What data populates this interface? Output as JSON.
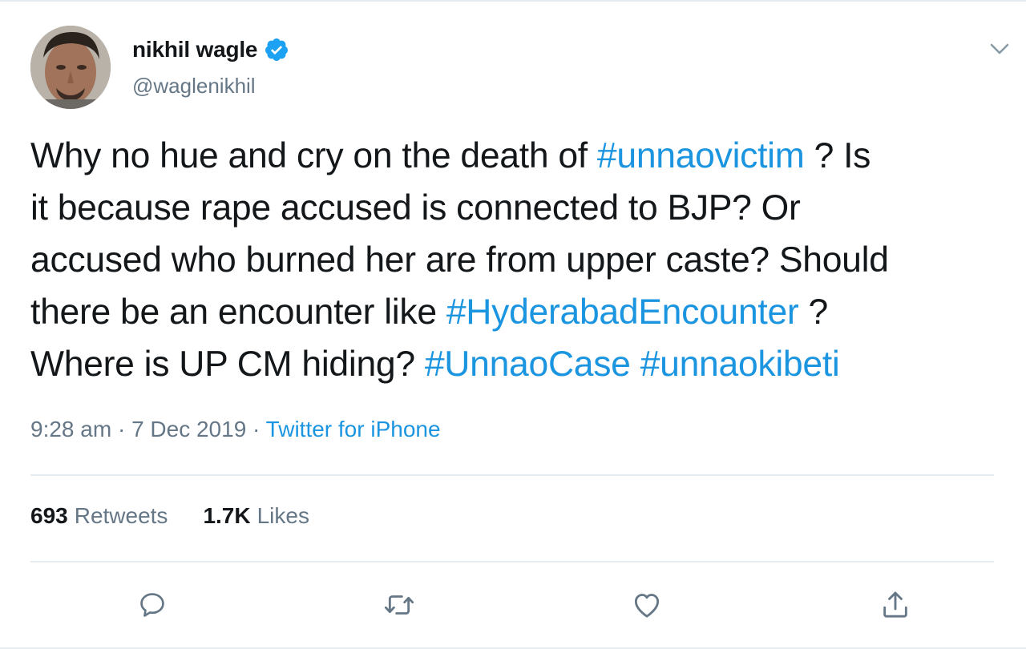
{
  "author": {
    "display_name": "nikhil wagle",
    "handle": "@waglenikhil",
    "verified": true
  },
  "tweet": {
    "lines": [
      [
        {
          "text": "Why no hue and cry on the death of ",
          "type": "text"
        },
        {
          "text": "#unnaovictim",
          "type": "hashtag"
        },
        {
          "text": " ? Is",
          "type": "text"
        }
      ],
      [
        {
          "text": "it because rape accused is connected to BJP? Or",
          "type": "text"
        }
      ],
      [
        {
          "text": "accused who burned her are from upper caste? Should",
          "type": "text"
        }
      ],
      [
        {
          "text": "there be an encounter like ",
          "type": "text"
        },
        {
          "text": "#HyderabadEncounter",
          "type": "hashtag"
        },
        {
          "text": " ?",
          "type": "text"
        }
      ],
      [
        {
          "text": "Where is UP CM hiding? ",
          "type": "text"
        },
        {
          "text": "#UnnaoCase",
          "type": "hashtag"
        },
        {
          "text": " ",
          "type": "text"
        },
        {
          "text": "#unnaokibeti",
          "type": "hashtag"
        }
      ]
    ]
  },
  "meta": {
    "time": "9:28 am",
    "separator1": " · ",
    "date": "7 Dec 2019",
    "separator2": " · ",
    "source": "Twitter for iPhone"
  },
  "stats": {
    "retweets_count": "693",
    "retweets_label": "Retweets",
    "likes_count": "1.7K",
    "likes_label": "Likes"
  },
  "actions": {
    "reply_icon": "reply-icon",
    "retweet_icon": "retweet-icon",
    "like_icon": "heart-icon",
    "share_icon": "share-icon"
  },
  "colors": {
    "link": "#1b95e0",
    "text": "#14171a",
    "muted": "#657786",
    "divider": "#e6ecf0"
  }
}
